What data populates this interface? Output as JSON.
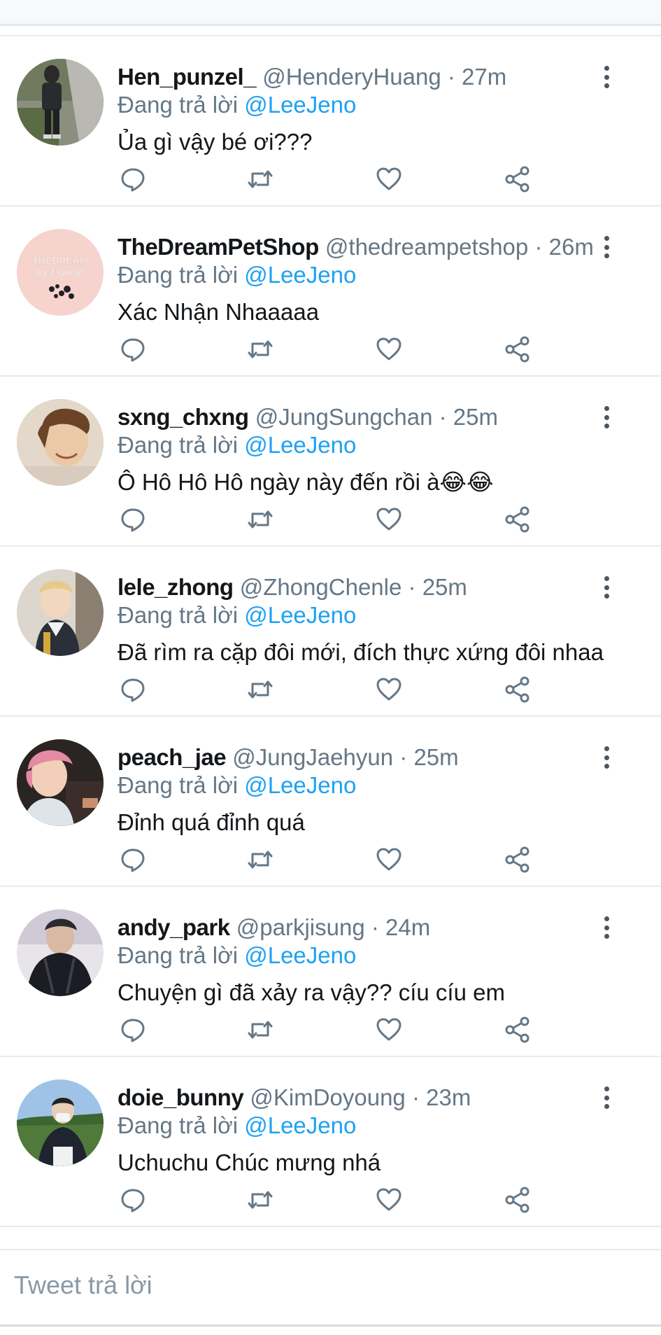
{
  "reply_prefix": "Đang trả lời",
  "reply_box": {
    "placeholder": "Tweet trả lời"
  },
  "colors": {
    "text_primary": "#14171a",
    "text_secondary": "#657786",
    "mention_blue": "#1da1f2",
    "divider": "#e6ecf0"
  },
  "tweets": [
    {
      "name": "Hen_punzel_",
      "handle": "@HenderyHuang",
      "dot": "·",
      "time": "27m",
      "reply_to": "@LeeJeno",
      "text": "Ủa gì vậy bé ơi???",
      "avatar_icon": "photo-person-standing-outdoors"
    },
    {
      "name": "TheDreamPetShop",
      "handle": "@thedreampetshop",
      "dot": "·",
      "time": "26m",
      "reply_to": "@LeeJeno",
      "text": "Xác Nhận Nhaaaaa",
      "avatar_icon": "logo-thedream-petshop",
      "avatar_logo_line1": "THEDREAM",
      "avatar_logo_line2": "PETSHOP"
    },
    {
      "name": "sxng_chxng",
      "handle": "@JungSungchan",
      "dot": "·",
      "time": "25m",
      "reply_to": "@LeeJeno",
      "text": "Ô Hô Hô Hô ngày này đến rồi à😂😂",
      "avatar_icon": "photo-smiling-face"
    },
    {
      "name": "lele_zhong",
      "handle": "@ZhongChenle",
      "dot": "·",
      "time": "25m",
      "reply_to": "@LeeJeno",
      "text": "Đã rìm ra cặp đôi mới, đích thực xứng đôi nhaa",
      "avatar_icon": "photo-person-portrait"
    },
    {
      "name": "peach_jae",
      "handle": "@JungJaehyun",
      "dot": "·",
      "time": "25m",
      "reply_to": "@LeeJeno",
      "text": "Đỉnh quá đỉnh quá",
      "avatar_icon": "photo-pink-hair-portrait"
    },
    {
      "name": "andy_park",
      "handle": "@parkjisung",
      "dot": "·",
      "time": "24m",
      "reply_to": "@LeeJeno",
      "text": "Chuyện gì đã xảy ra vậy?? cíu cíu em",
      "avatar_icon": "photo-person-dark-jacket"
    },
    {
      "name": "doie_bunny",
      "handle": "@KimDoyoung",
      "dot": "·",
      "time": "23m",
      "reply_to": "@LeeJeno",
      "text": "Uchuchu Chúc mưng nhá",
      "avatar_icon": "photo-person-mask-outdoors"
    }
  ]
}
